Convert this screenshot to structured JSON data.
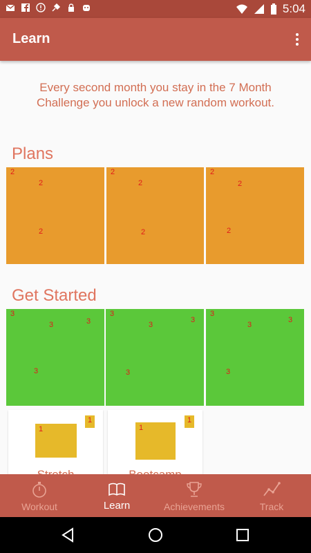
{
  "status_bar": {
    "time": "5:04"
  },
  "app_bar": {
    "title": "Learn"
  },
  "intro_text": "Every second month you stay in the 7 Month Challenge you unlock a new random workout.",
  "plans": {
    "title": "Plans",
    "tiles": [
      {
        "markers": [
          "2",
          "2",
          "2"
        ]
      },
      {
        "markers": [
          "2",
          "2",
          "2"
        ]
      },
      {
        "markers": [
          "2",
          "2",
          "2"
        ]
      }
    ]
  },
  "get_started": {
    "title": "Get Started",
    "tiles": [
      {
        "markers": [
          "3",
          "3",
          "3",
          "3"
        ]
      },
      {
        "markers": [
          "3",
          "3",
          "3",
          "3"
        ]
      },
      {
        "markers": [
          "3",
          "3",
          "3",
          "3"
        ]
      }
    ]
  },
  "workout_cards": [
    {
      "label": "Stretch",
      "markers": [
        "1",
        "1"
      ]
    },
    {
      "label": "Bootcamp",
      "markers": [
        "1",
        "1"
      ]
    }
  ],
  "bottom_nav": {
    "items": [
      {
        "label": "Workout",
        "icon": "stopwatch-icon",
        "active": false
      },
      {
        "label": "Learn",
        "icon": "book-icon",
        "active": true
      },
      {
        "label": "Achievements",
        "icon": "trophy-icon",
        "active": false
      },
      {
        "label": "Track",
        "icon": "line-chart-icon",
        "active": false
      }
    ]
  },
  "colors": {
    "primary": "#c05a4b",
    "primary_dark": "#a9483a",
    "accent_text": "#e0755f",
    "orange_tile": "#e89b2d",
    "green_tile": "#5bc83a",
    "yellow_image": "#e6b92a"
  }
}
